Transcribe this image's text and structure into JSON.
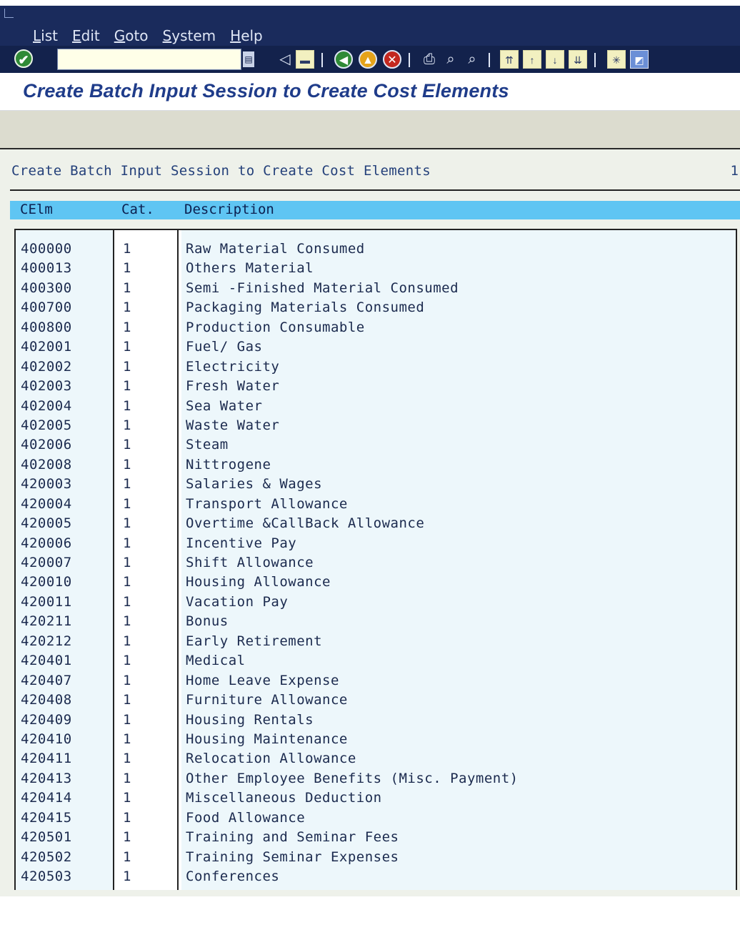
{
  "menu": {
    "items": [
      "List",
      "Edit",
      "Goto",
      "System",
      "Help"
    ]
  },
  "toolbar": {
    "command_value": "",
    "icons": [
      "enter-icon",
      "save-icon",
      "back-icon",
      "exit-icon",
      "cancel-icon",
      "print-icon",
      "find-icon",
      "find-next-icon",
      "first-page-icon",
      "previous-page-icon",
      "next-page-icon",
      "last-page-icon",
      "create-session-icon",
      "help-icon"
    ]
  },
  "title": "Create Batch Input Session to Create Cost Elements",
  "list": {
    "heading": "Create Batch Input Session to Create Cost Elements",
    "page_number": "1",
    "columns": [
      "CElm",
      "Cat.",
      "Description"
    ],
    "rows": [
      [
        "400000",
        "1",
        "Raw Material Consumed"
      ],
      [
        "400013",
        "1",
        "Others Material"
      ],
      [
        "400300",
        "1",
        "Semi -Finished Material Consumed"
      ],
      [
        "400700",
        "1",
        "Packaging Materials Consumed"
      ],
      [
        "400800",
        "1",
        "Production Consumable"
      ],
      [
        "402001",
        "1",
        "Fuel/ Gas"
      ],
      [
        "402002",
        "1",
        "Electricity"
      ],
      [
        "402003",
        "1",
        "Fresh Water"
      ],
      [
        "402004",
        "1",
        "Sea Water"
      ],
      [
        "402005",
        "1",
        "Waste Water"
      ],
      [
        "402006",
        "1",
        "Steam"
      ],
      [
        "402008",
        "1",
        "Nittrogene"
      ],
      [
        "420003",
        "1",
        "Salaries & Wages"
      ],
      [
        "420004",
        "1",
        "Transport Allowance"
      ],
      [
        "420005",
        "1",
        "Overtime &CallBack Allowance"
      ],
      [
        "420006",
        "1",
        "Incentive Pay"
      ],
      [
        "420007",
        "1",
        "Shift Allowance"
      ],
      [
        "420010",
        "1",
        "Housing Allowance"
      ],
      [
        "420011",
        "1",
        "Vacation Pay"
      ],
      [
        "420211",
        "1",
        "Bonus"
      ],
      [
        "420212",
        "1",
        "Early Retirement"
      ],
      [
        "420401",
        "1",
        "Medical"
      ],
      [
        "420407",
        "1",
        "Home Leave Expense"
      ],
      [
        "420408",
        "1",
        "Furniture Allowance"
      ],
      [
        "420409",
        "1",
        "Housing Rentals"
      ],
      [
        "420410",
        "1",
        "Housing Maintenance"
      ],
      [
        "420411",
        "1",
        "Relocation Allowance"
      ],
      [
        "420413",
        "1",
        "Other Employee Benefits (Misc. Payment)"
      ],
      [
        "420414",
        "1",
        "Miscellaneous Deduction"
      ],
      [
        "420415",
        "1",
        "Food Allowance"
      ],
      [
        "420501",
        "1",
        "Training and Seminar Fees"
      ],
      [
        "420502",
        "1",
        "Training Seminar Expenses"
      ],
      [
        "420503",
        "1",
        "Conferences"
      ]
    ]
  },
  "colors": {
    "menubar": "#1a2b5c",
    "title": "#1f3c8a",
    "column_header": "#5fc5f3"
  }
}
